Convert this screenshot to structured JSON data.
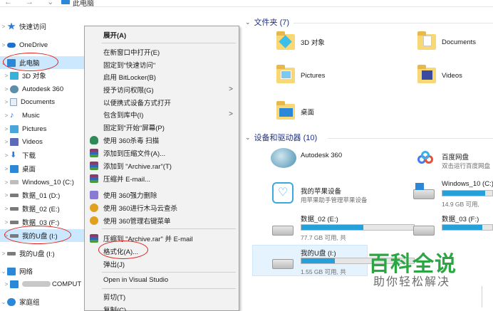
{
  "address_bar": {
    "breadcrumb": "此电脑",
    "nav_glyphs": "← → ⌄ ↑"
  },
  "nav_pane": {
    "items": [
      {
        "label": "快速访问",
        "icon": "star-icon",
        "color": "#2b7cd3",
        "expand": ">"
      },
      {
        "label": "OneDrive",
        "icon": "cloud-icon",
        "color": "#1e6fd0",
        "expand": ">"
      },
      {
        "label": "此电脑",
        "icon": "computer-icon",
        "color": "#2b88d8",
        "expand": "⌄"
      },
      {
        "label": "3D 对象",
        "icon": "cube-icon",
        "color": "#39b0d8",
        "expand": ">"
      },
      {
        "label": "Autodesk 360",
        "icon": "autodesk-icon",
        "color": "#5e8fa8",
        "expand": ">"
      },
      {
        "label": "Documents",
        "icon": "document-icon",
        "color": "#8aa0b8",
        "expand": ">"
      },
      {
        "label": "Music",
        "icon": "music-icon",
        "color": "#2b6ad3",
        "expand": ">"
      },
      {
        "label": "Pictures",
        "icon": "picture-icon",
        "color": "#4aa5d8",
        "expand": ">"
      },
      {
        "label": "Videos",
        "icon": "video-icon",
        "color": "#5c6bb8",
        "expand": ">"
      },
      {
        "label": "下载",
        "icon": "download-icon",
        "color": "#2b7cd3",
        "expand": ">"
      },
      {
        "label": "桌面",
        "icon": "desktop-icon",
        "color": "#2b88d8",
        "expand": ">"
      },
      {
        "label": "Windows_10 (C:)",
        "icon": "windows-drive-icon",
        "color": "#7a7a7a",
        "expand": ">"
      },
      {
        "label": "数据_01 (D:)",
        "icon": "drive-icon",
        "color": "#7a7a7a",
        "expand": ">"
      },
      {
        "label": "数据_02 (E:)",
        "icon": "drive-icon",
        "color": "#7a7a7a",
        "expand": ">"
      },
      {
        "label": "数据_03 (F:)",
        "icon": "drive-icon",
        "color": "#7a7a7a",
        "expand": ">"
      },
      {
        "label": "我的U盘 (I:)",
        "icon": "usb-drive-icon",
        "color": "#7a7a7a",
        "expand": ">"
      },
      {
        "label": "我的U盘 (I:)",
        "icon": "usb-drive-icon",
        "color": "#7a7a7a",
        "expand": ">"
      },
      {
        "label": "网络",
        "icon": "network-icon",
        "color": "#2b88d8",
        "expand": "⌄"
      },
      {
        "label": "COMPUT",
        "icon": "computer-icon",
        "color": "#2b88d8",
        "expand": ">"
      },
      {
        "label": "家庭组",
        "icon": "homegroup-icon",
        "color": "#2b88d8",
        "expand": "⌄"
      }
    ]
  },
  "context_menu": {
    "items": [
      {
        "label": "展开(A)",
        "bold": true,
        "icon": ""
      },
      {
        "label": "在新窗口中打开(E)",
        "icon": ""
      },
      {
        "label": "固定到\"快速访问\"",
        "icon": ""
      },
      {
        "label": "启用 BitLocker(B)",
        "icon": ""
      },
      {
        "label": "授予访问权限(G)",
        "icon": "",
        "submenu": ">"
      },
      {
        "label": "以便携式设备方式打开",
        "icon": ""
      },
      {
        "label": "包含到库中(I)",
        "icon": "",
        "submenu": ">"
      },
      {
        "label": "固定到\"开始\"屏幕(P)",
        "icon": ""
      },
      {
        "label": "使用 360杀毒 扫描",
        "icon": "shield-360-icon",
        "color": "#2e8b57"
      },
      {
        "label": "添加到压缩文件(A)...",
        "icon": "winrar-icon",
        "color": "#8b3a6b"
      },
      {
        "label": "添加到 \"Archive.rar\"(T)",
        "icon": "winrar-icon",
        "color": "#8b3a6b"
      },
      {
        "label": "压缩并 E-mail...",
        "icon": "winrar-icon",
        "color": "#8b3a6b"
      },
      {
        "label": "使用 360强力删除",
        "icon": "delete-360-icon",
        "color": "#8a7ad8"
      },
      {
        "label": "使用 360进行木马云查杀",
        "icon": "trojan-360-icon",
        "color": "#e0a020"
      },
      {
        "label": "使用 360管理右键菜单",
        "icon": "manage-360-icon",
        "color": "#e0a020"
      },
      {
        "label": "压缩到 \"Archive.rar\" 并 E-mail",
        "icon": "winrar-icon",
        "color": "#8b3a6b"
      },
      {
        "label": "格式化(A)...",
        "icon": ""
      },
      {
        "label": "弹出(J)",
        "icon": ""
      },
      {
        "label": "Open in Visual Studio",
        "icon": ""
      },
      {
        "label": "剪切(T)",
        "icon": ""
      },
      {
        "label": "复制(C)",
        "icon": ""
      }
    ]
  },
  "content": {
    "folders_header": "文件夹 (7)",
    "folders": [
      {
        "name": "3D 对象",
        "icon": "cube-folder-icon"
      },
      {
        "name": "Documents",
        "icon": "documents-folder-icon"
      },
      {
        "name": "Pictures",
        "icon": "pictures-folder-icon"
      },
      {
        "name": "Videos",
        "icon": "videos-folder-icon"
      },
      {
        "name": "桌面",
        "icon": "desktop-folder-icon"
      }
    ],
    "devices_header": "设备和驱动器 (10)",
    "devices": [
      {
        "name": "Autodesk 360",
        "sub": "",
        "icon": "autodesk-icon"
      },
      {
        "name": "百度网盘",
        "sub": "双击运行百度网盘",
        "icon": "baidu-netdisk-icon"
      },
      {
        "name": "我的苹果设备",
        "sub": "用苹果助手管理苹果设备",
        "icon": "apple-helper-icon"
      },
      {
        "name": "Windows_10 (C:)",
        "sub": "14.9 GB 可用,",
        "icon": "windows-drive-icon",
        "usage": 0.85
      },
      {
        "name": "数据_02 (E:)",
        "sub": "77.7 GB 可用, 共",
        "icon": "drive-icon",
        "usage": 0.55
      },
      {
        "name": "数据_03 (F:)",
        "sub": "",
        "icon": "drive-icon",
        "usage": 0.8
      },
      {
        "name": "我的U盘 (I:)",
        "sub": "1.55 GB 可用, 共",
        "icon": "usb-drive-icon",
        "usage": 0.3
      }
    ]
  },
  "watermark": {
    "title": "百科全说",
    "subtitle": "助你轻松解决"
  },
  "colors": {
    "selection": "#cce8ff",
    "accent": "#26a0da",
    "annotation": "#e0201b",
    "watermark": "#2aa642"
  }
}
